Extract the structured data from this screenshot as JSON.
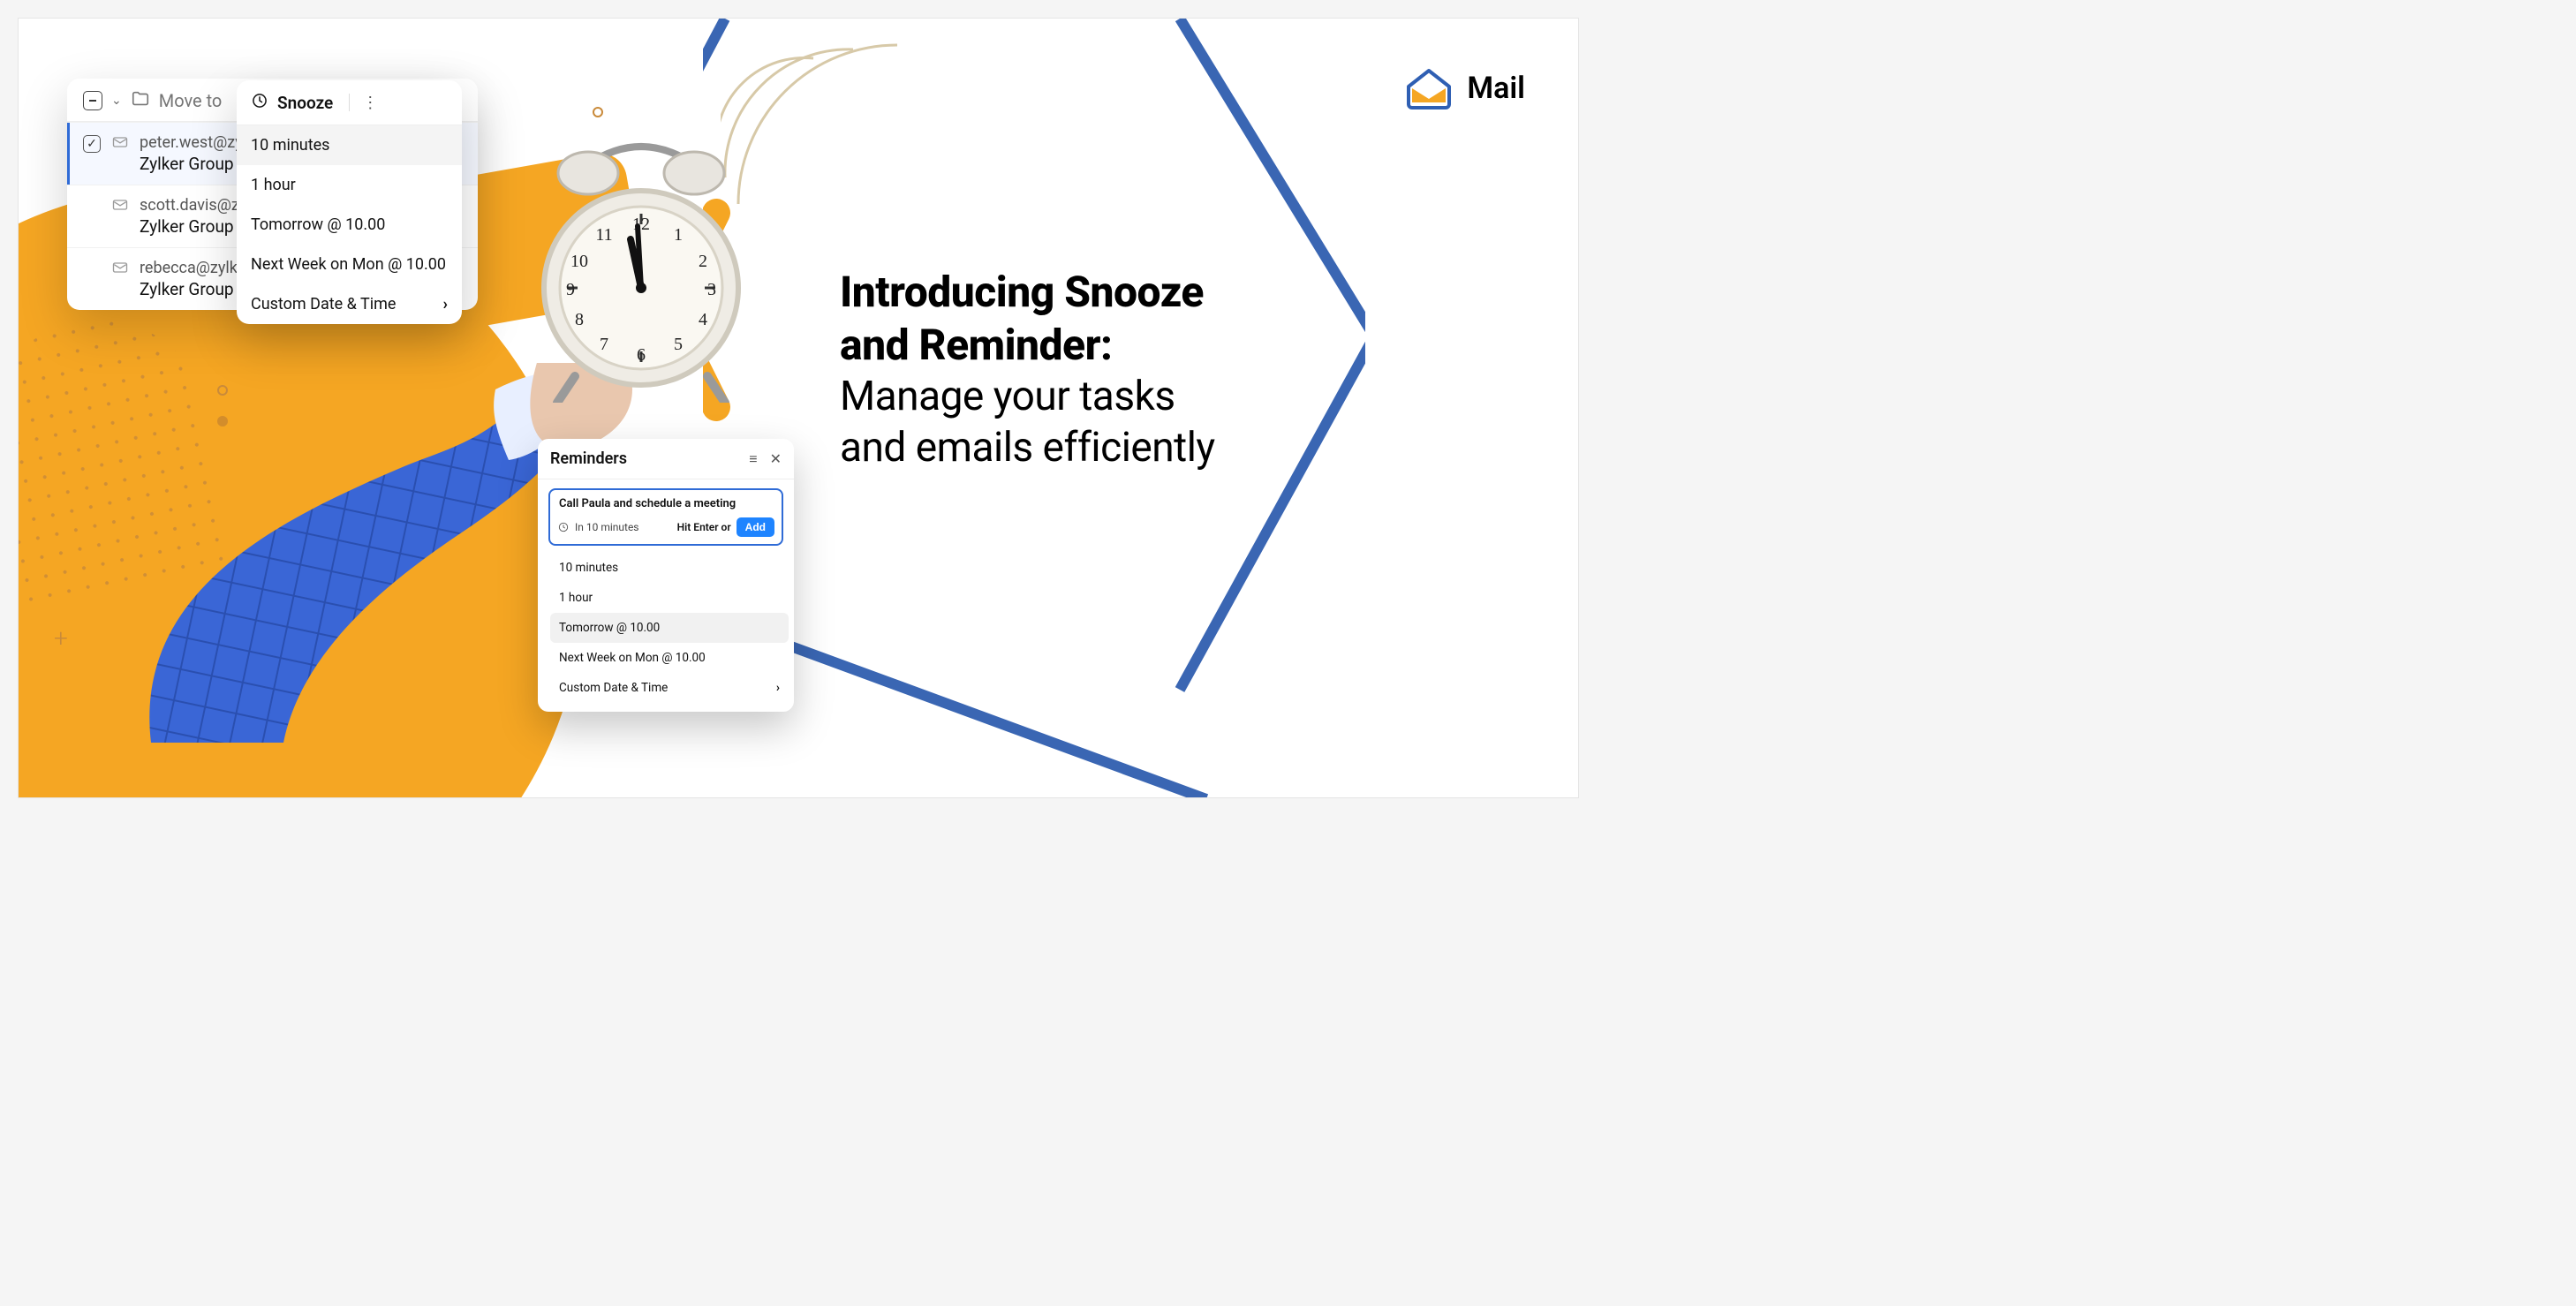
{
  "brand": {
    "name": "Mail"
  },
  "headline": {
    "bold_line1": "Introducing Snooze",
    "bold_line2": "and Reminder:",
    "light_line1": "Manage your tasks",
    "light_line2": "and emails efficiently"
  },
  "email_panel": {
    "move_to_label": "Move to",
    "rows": [
      {
        "from": "peter.west@zylk",
        "subject": "Zylker Group - C",
        "selected": true
      },
      {
        "from": "scott.davis@zylk",
        "subject": "Zylker Group - C",
        "selected": false
      },
      {
        "from": "rebecca@zylker.",
        "subject": "Zylker Group - C",
        "selected": false
      }
    ]
  },
  "snooze_menu": {
    "title": "Snooze",
    "options": [
      {
        "label": "10 minutes",
        "hover": true,
        "has_submenu": false
      },
      {
        "label": "1 hour",
        "hover": false,
        "has_submenu": false
      },
      {
        "label": "Tomorrow @ 10.00",
        "hover": false,
        "has_submenu": false
      },
      {
        "label": "Next Week on Mon @ 10.00",
        "hover": false,
        "has_submenu": false
      },
      {
        "label": "Custom Date & Time",
        "hover": false,
        "has_submenu": true
      }
    ]
  },
  "reminders_card": {
    "title": "Reminders",
    "input_subject": "Call Paula and schedule a meeting",
    "input_when": "In 10 minutes",
    "hint_text": "Hit Enter or",
    "add_button": "Add",
    "options": [
      {
        "label": "10 minutes",
        "hover": false,
        "has_submenu": false
      },
      {
        "label": "1 hour",
        "hover": false,
        "has_submenu": false
      },
      {
        "label": "Tomorrow @ 10.00",
        "hover": true,
        "has_submenu": false
      },
      {
        "label": "Next Week on Mon @ 10.00",
        "hover": false,
        "has_submenu": false
      },
      {
        "label": "Custom Date & Time",
        "hover": false,
        "has_submenu": true
      }
    ]
  },
  "colors": {
    "orange": "#f5a623",
    "blue": "#3a66b3",
    "brand_blue": "#1e84ff"
  }
}
